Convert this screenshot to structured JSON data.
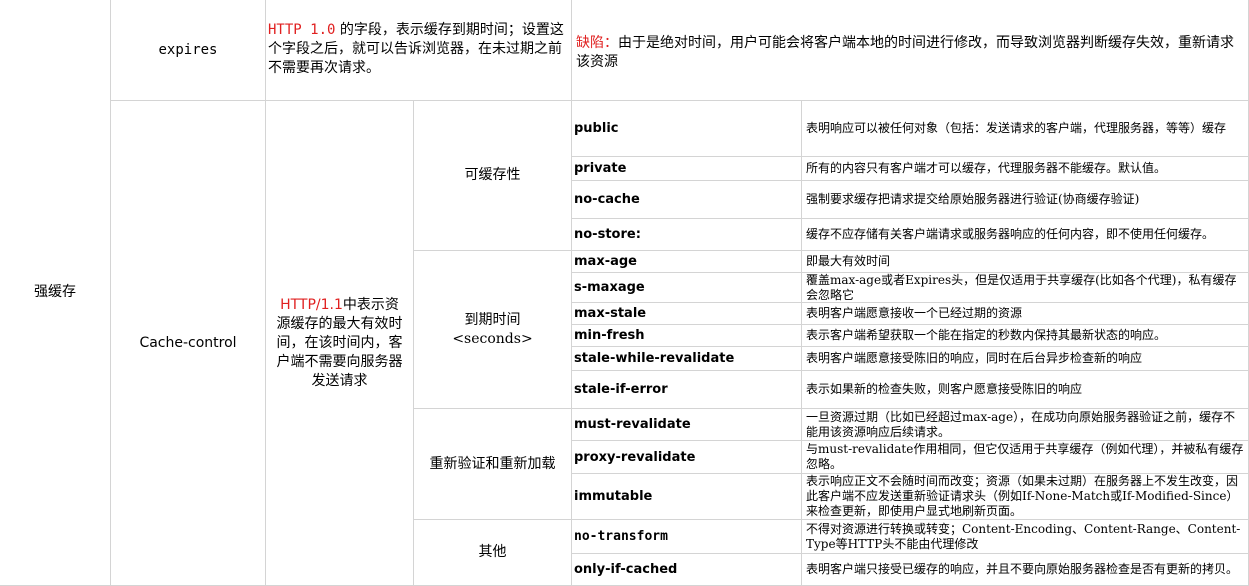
{
  "category": "强缓存",
  "expires": {
    "name": "expires",
    "desc_highlight": "HTTP 1.0",
    "desc_rest": " 的字段，表示缓存到期时间；设置这个字段之后，就可以告诉浏览器，在未过期之前不需要再次请求。",
    "drawback_label": "缺陷：",
    "drawback_text": "由于是绝对时间，用户可能会将客户端本地的时间进行修改，而导致浏览器判断缓存失效，重新请求该资源"
  },
  "cache_control": {
    "name": "Cache-control",
    "desc_highlight": "HTTP/1.1",
    "desc_rest": "中表示资源缓存的最大有效时间，在该时间内，客户端不需要向服务器发送请求",
    "groups": [
      {
        "label": "可缓存性",
        "directives": [
          {
            "name": "public",
            "desc": "表明响应可以被任何对象（包括：发送请求的客户端，代理服务器，等等）缓存"
          },
          {
            "name": "private",
            "desc": "所有的内容只有客户端才可以缓存，代理服务器不能缓存。默认值。"
          },
          {
            "name": "no-cache",
            "desc": "强制要求缓存把请求提交给原始服务器进行验证(协商缓存验证)"
          },
          {
            "name": "no-store:",
            "desc": "缓存不应存储有关客户端请求或服务器响应的任何内容，即不使用任何缓存。"
          }
        ]
      },
      {
        "label": "到期时间\n<seconds>",
        "directives": [
          {
            "name": "max-age",
            "desc": "即最大有效时间"
          },
          {
            "name": "s-maxage",
            "desc": "覆盖max-age或者Expires头，但是仅适用于共享缓存(比如各个代理)，私有缓存会忽略它"
          },
          {
            "name": "max-stale",
            "desc": "表明客户端愿意接收一个已经过期的资源"
          },
          {
            "name": "min-fresh",
            "desc": "表示客户端希望获取一个能在指定的秒数内保持其最新状态的响应。"
          },
          {
            "name": "stale-while-revalidate",
            "desc": "表明客户端愿意接受陈旧的响应，同时在后台异步检查新的响应"
          },
          {
            "name": "stale-if-error",
            "desc": "表示如果新的检查失败，则客户愿意接受陈旧的响应"
          }
        ]
      },
      {
        "label": "重新验证和重新加载",
        "directives": [
          {
            "name": "must-revalidate",
            "desc": "一旦资源过期（比如已经超过max-age），在成功向原始服务器验证之前，缓存不能用该资源响应后续请求。"
          },
          {
            "name": "proxy-revalidate",
            "desc": "与must-revalidate作用相同，但它仅适用于共享缓存（例如代理），并被私有缓存忽略。"
          },
          {
            "name": "immutable",
            "desc": "表示响应正文不会随时间而改变；资源（如果未过期）在服务器上不发生改变，因此客户端不应发送重新验证请求头（例如If-None-Match或If-Modified-Since）来检查更新，即使用户显式地刷新页面。"
          }
        ]
      },
      {
        "label": "其他",
        "directives": [
          {
            "name": "no-transform",
            "desc": "不得对资源进行转换或转变；Content-Encoding、Content-Range、Content-Type等HTTP头不能由代理修改"
          },
          {
            "name": "only-if-cached",
            "desc": "表明客户端只接受已缓存的响应，并且不要向原始服务器检查是否有更新的拷贝。"
          }
        ]
      }
    ]
  }
}
